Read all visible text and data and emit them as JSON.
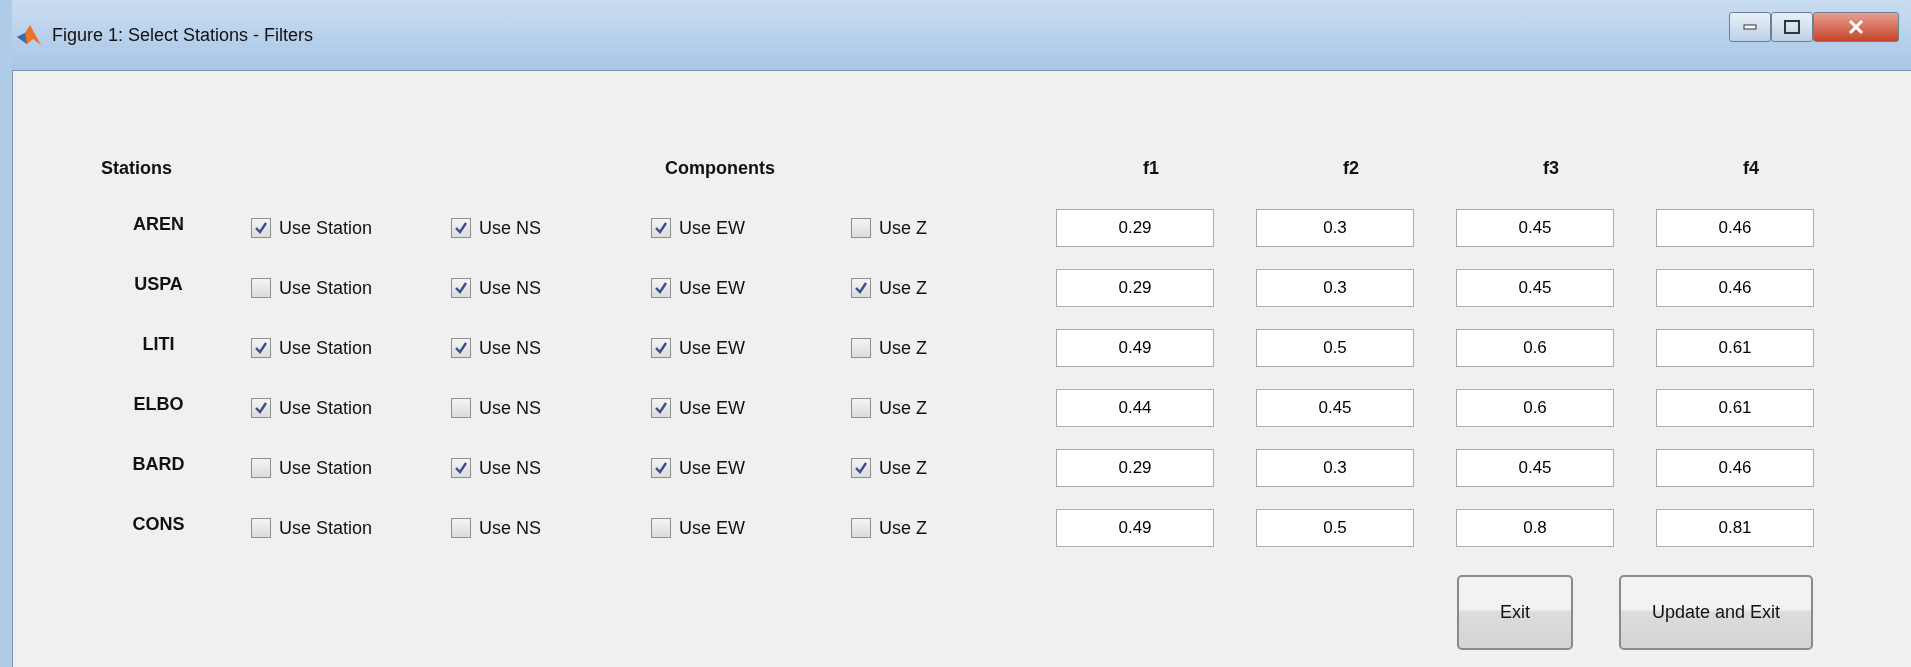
{
  "window": {
    "title": "Figure 1: Select Stations - Filters"
  },
  "headers": {
    "stations": "Stations",
    "components": "Components",
    "filters": [
      "f1",
      "f2",
      "f3",
      "f4"
    ]
  },
  "stations": [
    {
      "name": "AREN",
      "options": [
        {
          "label": "Use Station",
          "checked": true
        },
        {
          "label": "Use NS",
          "checked": true
        },
        {
          "label": "Use EW",
          "checked": true
        },
        {
          "label": "Use Z",
          "checked": false
        }
      ],
      "filters": [
        "0.29",
        "0.3",
        "0.45",
        "0.46"
      ]
    },
    {
      "name": "USPA",
      "options": [
        {
          "label": "Use Station",
          "checked": false
        },
        {
          "label": "Use NS",
          "checked": true
        },
        {
          "label": "Use EW",
          "checked": true
        },
        {
          "label": "Use Z",
          "checked": true
        }
      ],
      "filters": [
        "0.29",
        "0.3",
        "0.45",
        "0.46"
      ]
    },
    {
      "name": "LITI",
      "options": [
        {
          "label": "Use Station",
          "checked": true
        },
        {
          "label": "Use NS",
          "checked": true
        },
        {
          "label": "Use EW",
          "checked": true
        },
        {
          "label": "Use Z",
          "checked": false
        }
      ],
      "filters": [
        "0.49",
        "0.5",
        "0.6",
        "0.61"
      ]
    },
    {
      "name": "ELBO",
      "options": [
        {
          "label": "Use Station",
          "checked": true
        },
        {
          "label": "Use NS",
          "checked": false
        },
        {
          "label": "Use EW",
          "checked": true
        },
        {
          "label": "Use Z",
          "checked": false
        }
      ],
      "filters": [
        "0.44",
        "0.45",
        "0.6",
        "0.61"
      ]
    },
    {
      "name": "BARD",
      "options": [
        {
          "label": "Use Station",
          "checked": false
        },
        {
          "label": "Use NS",
          "checked": true
        },
        {
          "label": "Use EW",
          "checked": true
        },
        {
          "label": "Use Z",
          "checked": true
        }
      ],
      "filters": [
        "0.29",
        "0.3",
        "0.45",
        "0.46"
      ]
    },
    {
      "name": "CONS",
      "options": [
        {
          "label": "Use Station",
          "checked": false
        },
        {
          "label": "Use NS",
          "checked": false
        },
        {
          "label": "Use EW",
          "checked": false
        },
        {
          "label": "Use Z",
          "checked": false
        }
      ],
      "filters": [
        "0.49",
        "0.5",
        "0.8",
        "0.81"
      ]
    }
  ],
  "buttons": [
    "Exit",
    "Update and Exit"
  ]
}
